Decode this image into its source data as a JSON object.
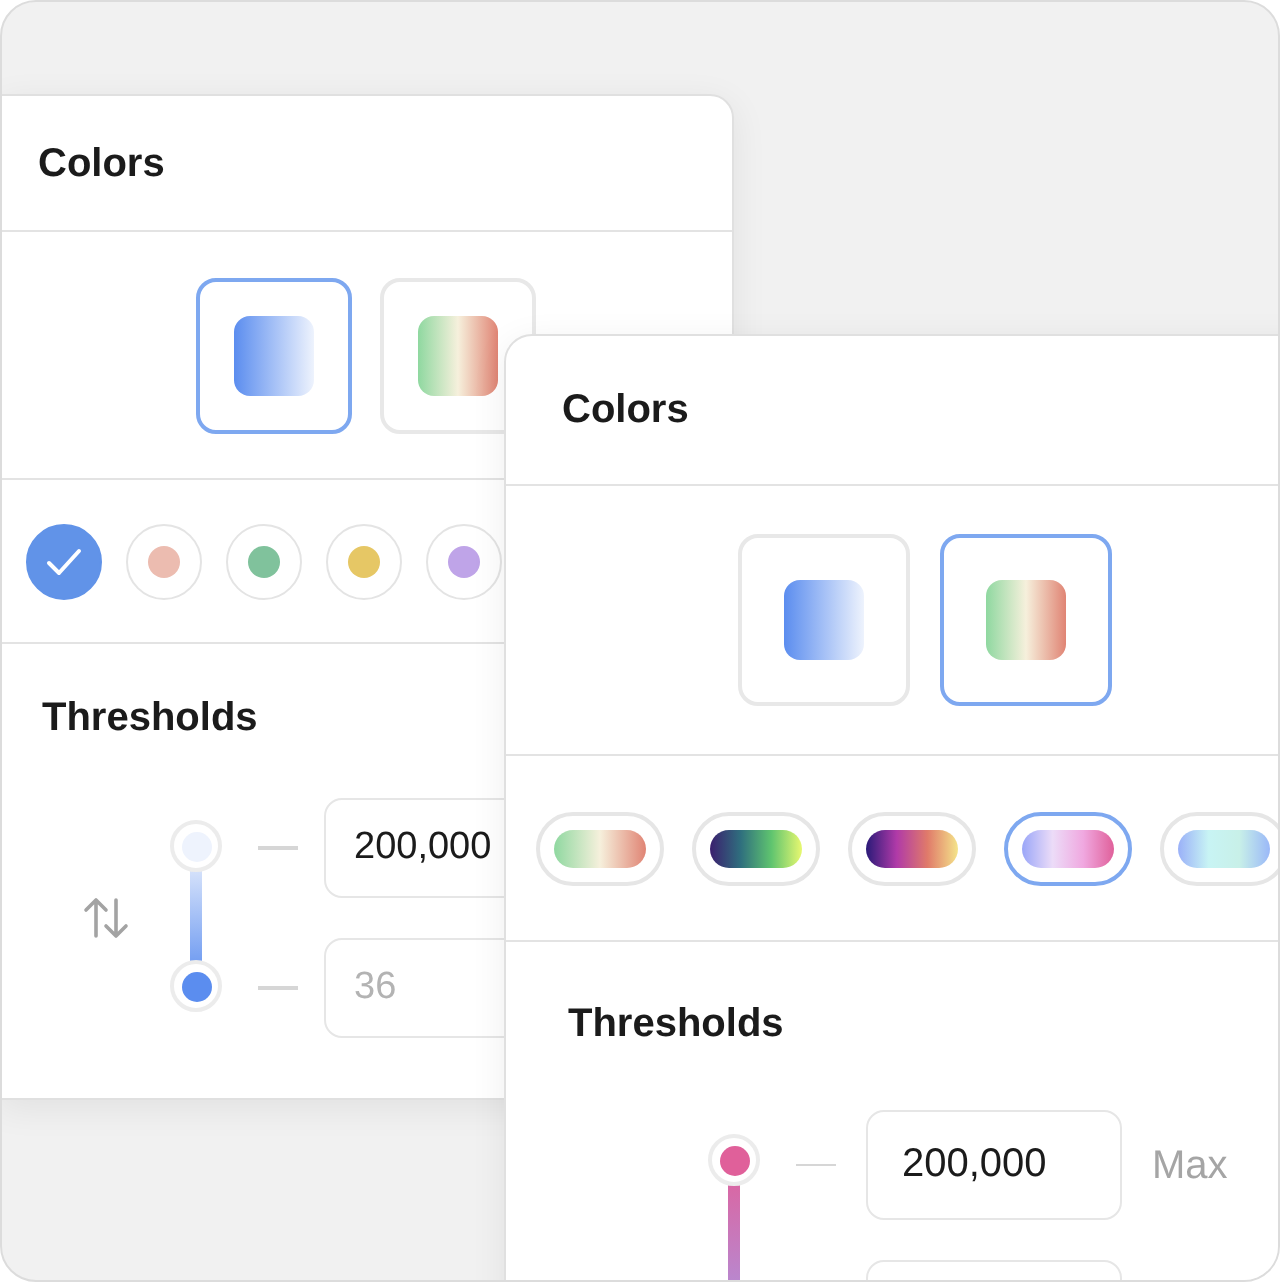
{
  "panels": [
    {
      "title": "Colors",
      "modes": [
        {
          "kind": "sequential",
          "selected": true
        },
        {
          "kind": "diverging",
          "selected": false
        }
      ],
      "swatches": [
        {
          "kind": "dot",
          "color": "#6193e8",
          "selected": true
        },
        {
          "kind": "dot",
          "color": "#ecbcb0",
          "selected": false
        },
        {
          "kind": "dot",
          "color": "#80c29c",
          "selected": false
        },
        {
          "kind": "dot",
          "color": "#e6c765",
          "selected": false
        },
        {
          "kind": "dot",
          "color": "#bfa4e8",
          "selected": false
        }
      ],
      "thresholds": {
        "title": "Thresholds",
        "swappable": true,
        "max": {
          "value": "200,000"
        },
        "min": {
          "placeholder": "36"
        }
      }
    },
    {
      "title": "Colors",
      "modes": [
        {
          "kind": "sequential",
          "selected": false
        },
        {
          "kind": "diverging",
          "selected": true
        }
      ],
      "swatches": [
        {
          "kind": "spectral",
          "selected": false
        },
        {
          "kind": "viridis",
          "selected": false
        },
        {
          "kind": "plasma",
          "selected": false
        },
        {
          "kind": "orchid",
          "selected": true
        },
        {
          "kind": "ice",
          "selected": false
        }
      ],
      "thresholds": {
        "title": "Thresholds",
        "max": {
          "value": "200,000",
          "label": "Max"
        }
      }
    }
  ]
}
